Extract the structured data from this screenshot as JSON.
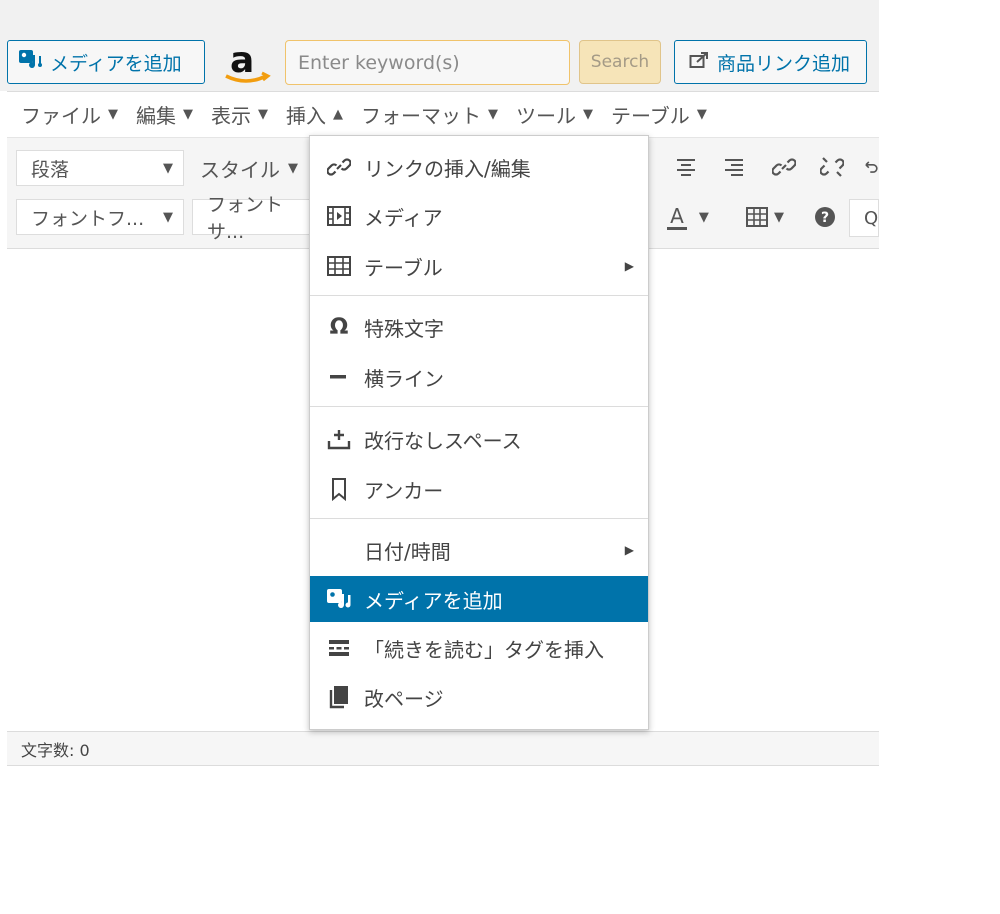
{
  "top": {
    "add_media_label": "メディアを追加",
    "keyword_placeholder": "Enter keyword(s)",
    "search_label": "Search",
    "product_link_label": "商品リンク追加"
  },
  "menubar": {
    "items": [
      {
        "label": "ファイル",
        "caret": "▼"
      },
      {
        "label": "編集",
        "caret": "▼"
      },
      {
        "label": "表示",
        "caret": "▼"
      },
      {
        "label": "挿入",
        "caret": "▲"
      },
      {
        "label": "フォーマット",
        "caret": "▼"
      },
      {
        "label": "ツール",
        "caret": "▼"
      },
      {
        "label": "テーブル",
        "caret": "▼"
      }
    ]
  },
  "toolbar": {
    "paragraph": "段落",
    "style": "スタイル",
    "font_family": "フォントフ...",
    "font_size": "フォントサ...",
    "search_fragment": "Q"
  },
  "status": {
    "word_count": "文字数: 0"
  },
  "dropdown": {
    "items": [
      {
        "label": "リンクの挿入/編集",
        "icon": "link-icon"
      },
      {
        "label": "メディア",
        "icon": "media-icon"
      },
      {
        "label": "テーブル",
        "icon": "table-icon",
        "submenu": true
      },
      {
        "label": "特殊文字",
        "icon": "omega-icon"
      },
      {
        "label": "横ライン",
        "icon": "hr-icon"
      },
      {
        "label": "改行なしスペース",
        "icon": "nbsp-icon"
      },
      {
        "label": "アンカー",
        "icon": "bookmark-icon"
      },
      {
        "label": "日付/時間",
        "icon": "",
        "submenu": true
      },
      {
        "label": "メディアを追加",
        "icon": "add-media-icon",
        "active": true
      },
      {
        "label": "「続きを読む」タグを挿入",
        "icon": "read-more-icon"
      },
      {
        "label": "改ページ",
        "icon": "page-break-icon"
      }
    ]
  },
  "colors": {
    "accent": "#0073aa",
    "search_bg": "#f6e4b8",
    "input_border": "#f0c36b"
  }
}
